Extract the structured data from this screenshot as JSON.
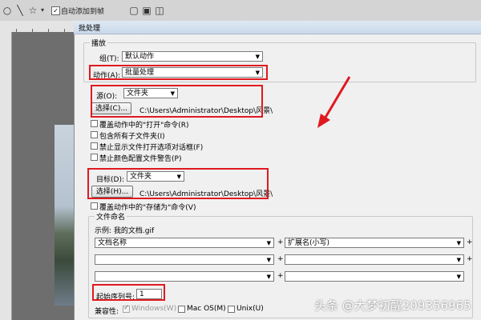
{
  "toolbar": {
    "auto_add_label": "自动添加到帧"
  },
  "ruler": {
    "ticks": [
      "",
      "",
      ""
    ]
  },
  "dialog": {
    "title": "批处理",
    "play": {
      "legend": "播放",
      "group_label": "组(T):",
      "group_value": "默认动作",
      "action_label": "动作(A):",
      "action_value": "批量处理"
    },
    "source": {
      "label": "源(O):",
      "value": "文件夹",
      "choose_button": "选择(C)...",
      "path": "C:\\Users\\Administrator\\Desktop\\风景\\",
      "options": [
        {
          "label": "覆盖动作中的\"打开\"命令(R)",
          "checked": false
        },
        {
          "label": "包含所有子文件夹(I)",
          "checked": false
        },
        {
          "label": "禁止显示文件打开选项对话框(F)",
          "checked": false
        },
        {
          "label": "禁止颜色配置文件警告(P)",
          "checked": false
        }
      ]
    },
    "destination": {
      "label": "目标(D):",
      "value": "文件夹",
      "choose_button": "选择(H)...",
      "path": "C:\\Users\\Administrator\\Desktop\\风景\\",
      "override_save": "覆盖动作中的\"存储为\"命令(V)"
    },
    "naming": {
      "legend": "文件命名",
      "example": "示例: 我的文档.gif",
      "row1_left": "文档名称",
      "row1_right": "扩展名(小写)",
      "row2_left": "",
      "row2_right": "",
      "row3_left": "",
      "row3_right": "",
      "plus": "+",
      "start_serial_label": "起始序列号:",
      "start_serial_value": "1",
      "compat_label": "兼容性:",
      "compat_windows": "Windows(W)",
      "compat_mac": "Mac OS(M)",
      "compat_unix": "Unix(U)"
    }
  },
  "watermark": "头条 @大梦初醒209356965",
  "colors": {
    "highlight": "#e0191f",
    "arrow": "#e0191f"
  }
}
